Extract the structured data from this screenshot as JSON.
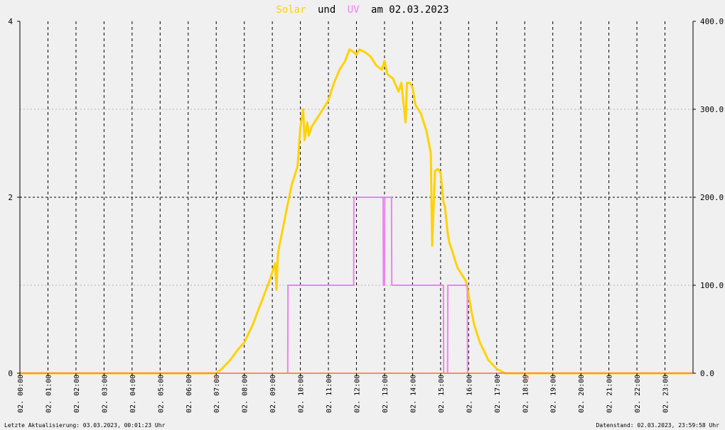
{
  "title": {
    "solar_word": "Solar",
    "und_word": "und",
    "uv_word": "UV",
    "rest": "am 02.03.2023"
  },
  "footer": {
    "left": "Letzte Aktualisierung: 03.03.2023, 00:01:23 Uhr",
    "right": "Datenstand: 02.03.2023, 23:59:58 Uhr"
  },
  "colors": {
    "background": "#f0f0f0",
    "solar": "#ffd200",
    "uv": "#ee82ee",
    "baseline": "#ff8c5a",
    "grid": "#000000",
    "minor_grid": "#b4b4b4",
    "text": "#000000"
  },
  "chart_data": {
    "type": "line",
    "grid": true,
    "x_tick_labels": [
      "02. 00:00",
      "02. 01:00",
      "02. 02:00",
      "02. 03:00",
      "02. 04:00",
      "02. 05:00",
      "02. 06:00",
      "02. 07:00",
      "02. 08:00",
      "02. 09:00",
      "02. 10:00",
      "02. 11:00",
      "02. 12:00",
      "02. 13:00",
      "02. 14:00",
      "02. 15:00",
      "02. 16:00",
      "02. 17:00",
      "02. 18:00",
      "02. 19:00",
      "02. 20:00",
      "02. 21:00",
      "02. 22:00",
      "02. 23:00"
    ],
    "x_range_hours": [
      0,
      24
    ],
    "y_left": {
      "ticks": [
        "0",
        "2",
        "4"
      ],
      "range": [
        0,
        4
      ]
    },
    "y_right": {
      "ticks": [
        "0.0",
        "100.0",
        "200.0",
        "300.0",
        "400.0"
      ],
      "range": [
        0,
        400
      ]
    },
    "zero_markers": [
      "0",
      "0"
    ],
    "series": [
      {
        "name": "Solar",
        "axis": "right",
        "x": [
          0,
          7.0,
          7.2,
          7.5,
          7.8,
          8.0,
          8.3,
          8.6,
          8.9,
          9.1,
          9.15,
          9.2,
          9.25,
          9.35,
          9.5,
          9.7,
          9.9,
          10.0,
          10.1,
          10.15,
          10.25,
          10.3,
          10.4,
          10.6,
          10.8,
          11.0,
          11.2,
          11.4,
          11.6,
          11.75,
          11.9,
          12.0,
          12.1,
          12.3,
          12.5,
          12.7,
          12.9,
          13.0,
          13.1,
          13.3,
          13.5,
          13.6,
          13.75,
          13.8,
          13.9,
          14.0,
          14.1,
          14.3,
          14.5,
          14.65,
          14.7,
          14.8,
          14.9,
          15.0,
          15.1,
          15.15,
          15.2,
          15.25,
          15.3,
          15.5,
          15.6,
          15.8,
          15.9,
          16.0,
          16.1,
          16.2,
          16.4,
          16.7,
          17.0,
          17.3,
          17.6,
          17.9,
          18.0,
          18.1,
          24
        ],
        "values": [
          0,
          0,
          5,
          15,
          28,
          35,
          55,
          80,
          105,
          125,
          95,
          135,
          145,
          160,
          185,
          215,
          235,
          280,
          300,
          265,
          285,
          270,
          280,
          290,
          300,
          310,
          330,
          345,
          355,
          368,
          365,
          362,
          368,
          365,
          360,
          350,
          345,
          355,
          340,
          335,
          320,
          330,
          285,
          330,
          330,
          325,
          305,
          295,
          275,
          250,
          145,
          230,
          232,
          228,
          195,
          190,
          175,
          160,
          150,
          130,
          120,
          110,
          105,
          90,
          70,
          55,
          35,
          15,
          5,
          0,
          0,
          0,
          0,
          0,
          0
        ]
      },
      {
        "name": "UV",
        "axis": "left",
        "step": true,
        "x": [
          0,
          9.55,
          9.56,
          11.9,
          11.91,
          12.95,
          12.96,
          13.0,
          13.01,
          13.25,
          13.26,
          13.4,
          13.41,
          15.1,
          15.11,
          15.25,
          15.26,
          15.95,
          15.96,
          24
        ],
        "values": [
          0,
          0,
          1,
          1,
          2,
          2,
          1,
          1,
          2,
          2,
          1,
          1,
          1,
          1,
          0,
          0,
          1,
          1,
          0,
          0
        ]
      }
    ]
  }
}
